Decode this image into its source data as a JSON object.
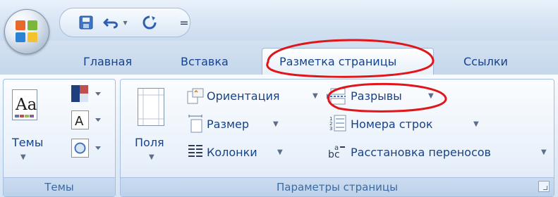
{
  "tabs": [
    {
      "label": "Главная"
    },
    {
      "label": "Вставка"
    },
    {
      "label": "Разметка страницы"
    },
    {
      "label": "Ссылки"
    }
  ],
  "ribbon": {
    "themes_group": {
      "label": "Темы",
      "themes_button": "Темы"
    },
    "page_setup_group": {
      "label": "Параметры страницы",
      "margins_button": "Поля",
      "orientation_button": "Ориентация",
      "size_button": "Размер",
      "columns_button": "Колонки",
      "breaks_button": "Разрывы",
      "line_numbers_button": "Номера строк",
      "hyphenation_button": "Расстановка переносов"
    }
  },
  "icons": {
    "save": "save-icon",
    "undo": "undo-icon",
    "redo": "redo-icon",
    "qat_customize": "chevron-down-icon"
  },
  "colors": {
    "accent": "#15428b",
    "annotation_red": "#e0161b"
  }
}
